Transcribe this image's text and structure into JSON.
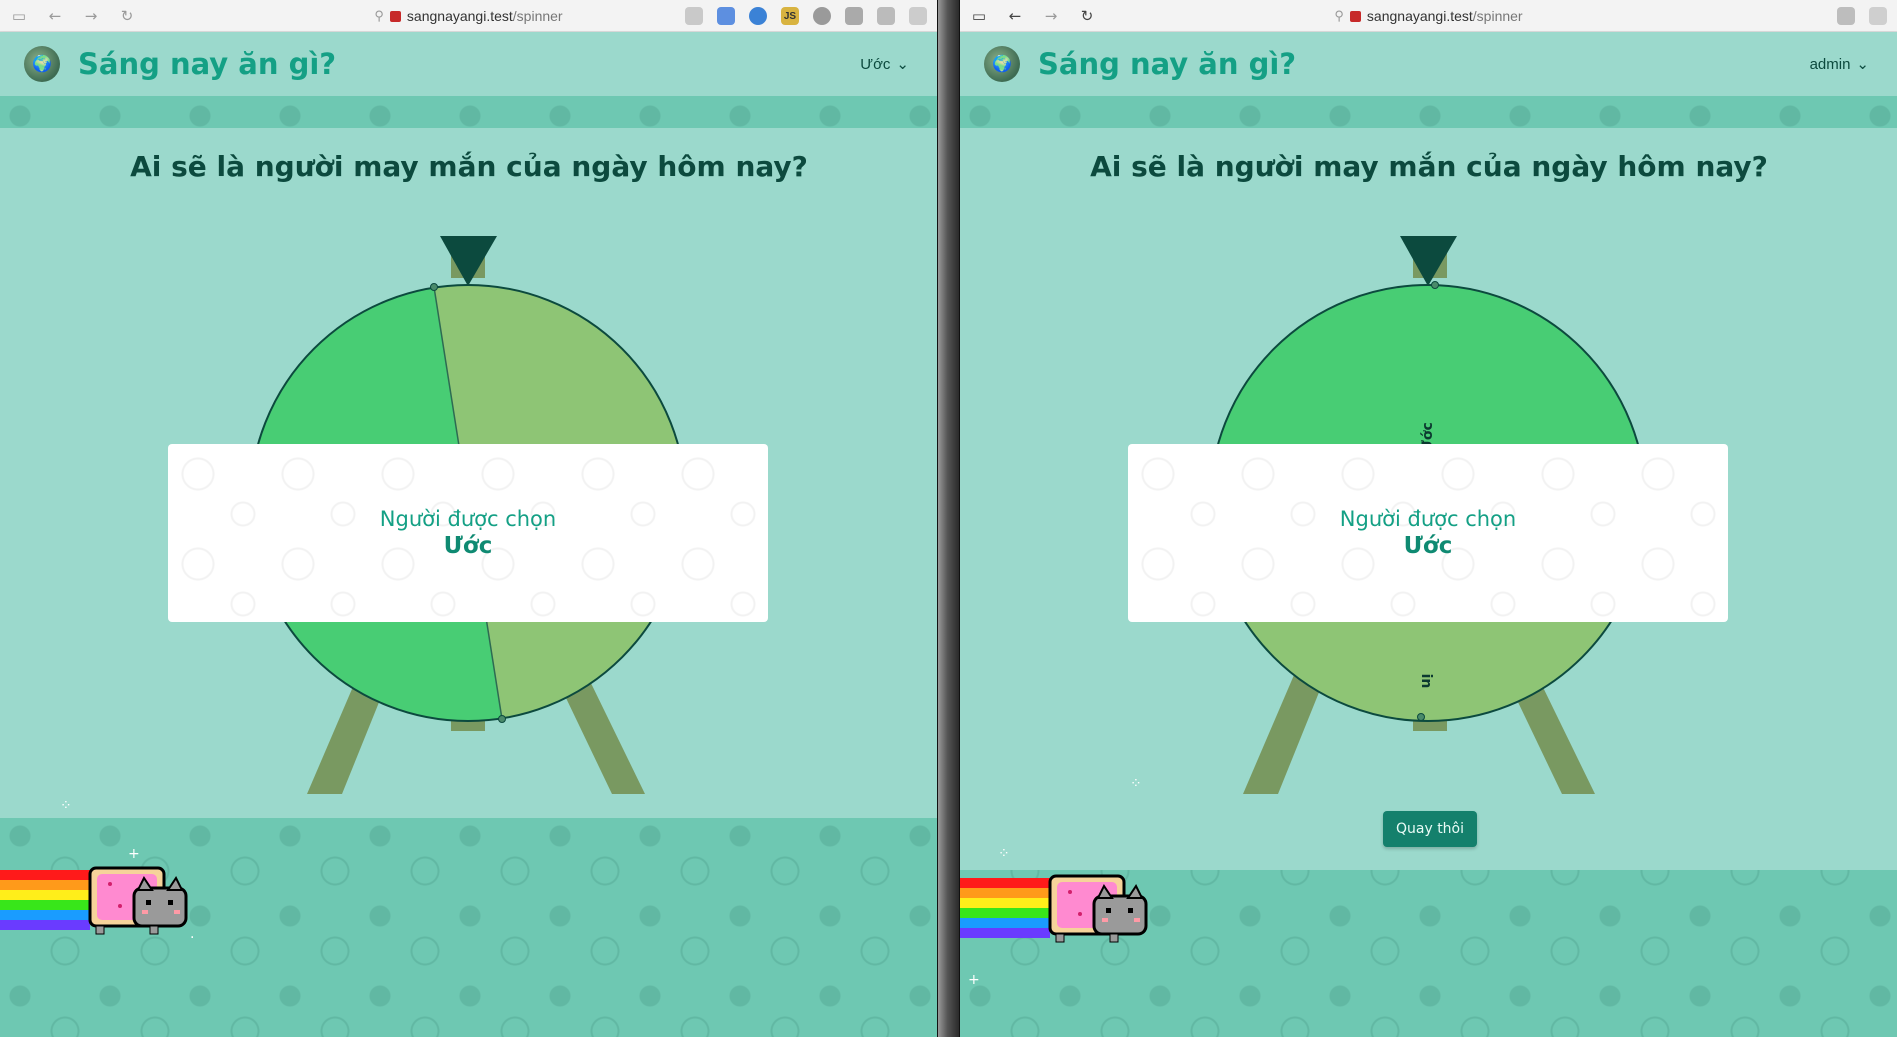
{
  "browser_left": {
    "host": "sangnayangi.test",
    "path": "/spinner"
  },
  "browser_right": {
    "host": "sangnayangi.test",
    "path": "/spinner"
  },
  "site": {
    "title": "Sáng nay ăn gì?"
  },
  "left_window": {
    "user_menu": "Ước",
    "heading": "Ai sẽ là người may mắn của ngày hôm nay?",
    "result_label": "Người được chọn",
    "result_name": "Ước"
  },
  "right_window": {
    "user_menu": "admin",
    "heading": "Ai sẽ là người may mắn của ngày hôm nay?",
    "wheel_labels": [
      "Ước",
      "in"
    ],
    "result_label": "Người được chọn",
    "result_name": "Ước",
    "spin_button": "Quay thôi"
  },
  "colors": {
    "primary_green": "#14a085",
    "wheel_green": "#48cd74",
    "wheel_olive": "#8ec575",
    "stand": "#799961",
    "pointer": "#0c4a3e",
    "button": "#14806c"
  }
}
